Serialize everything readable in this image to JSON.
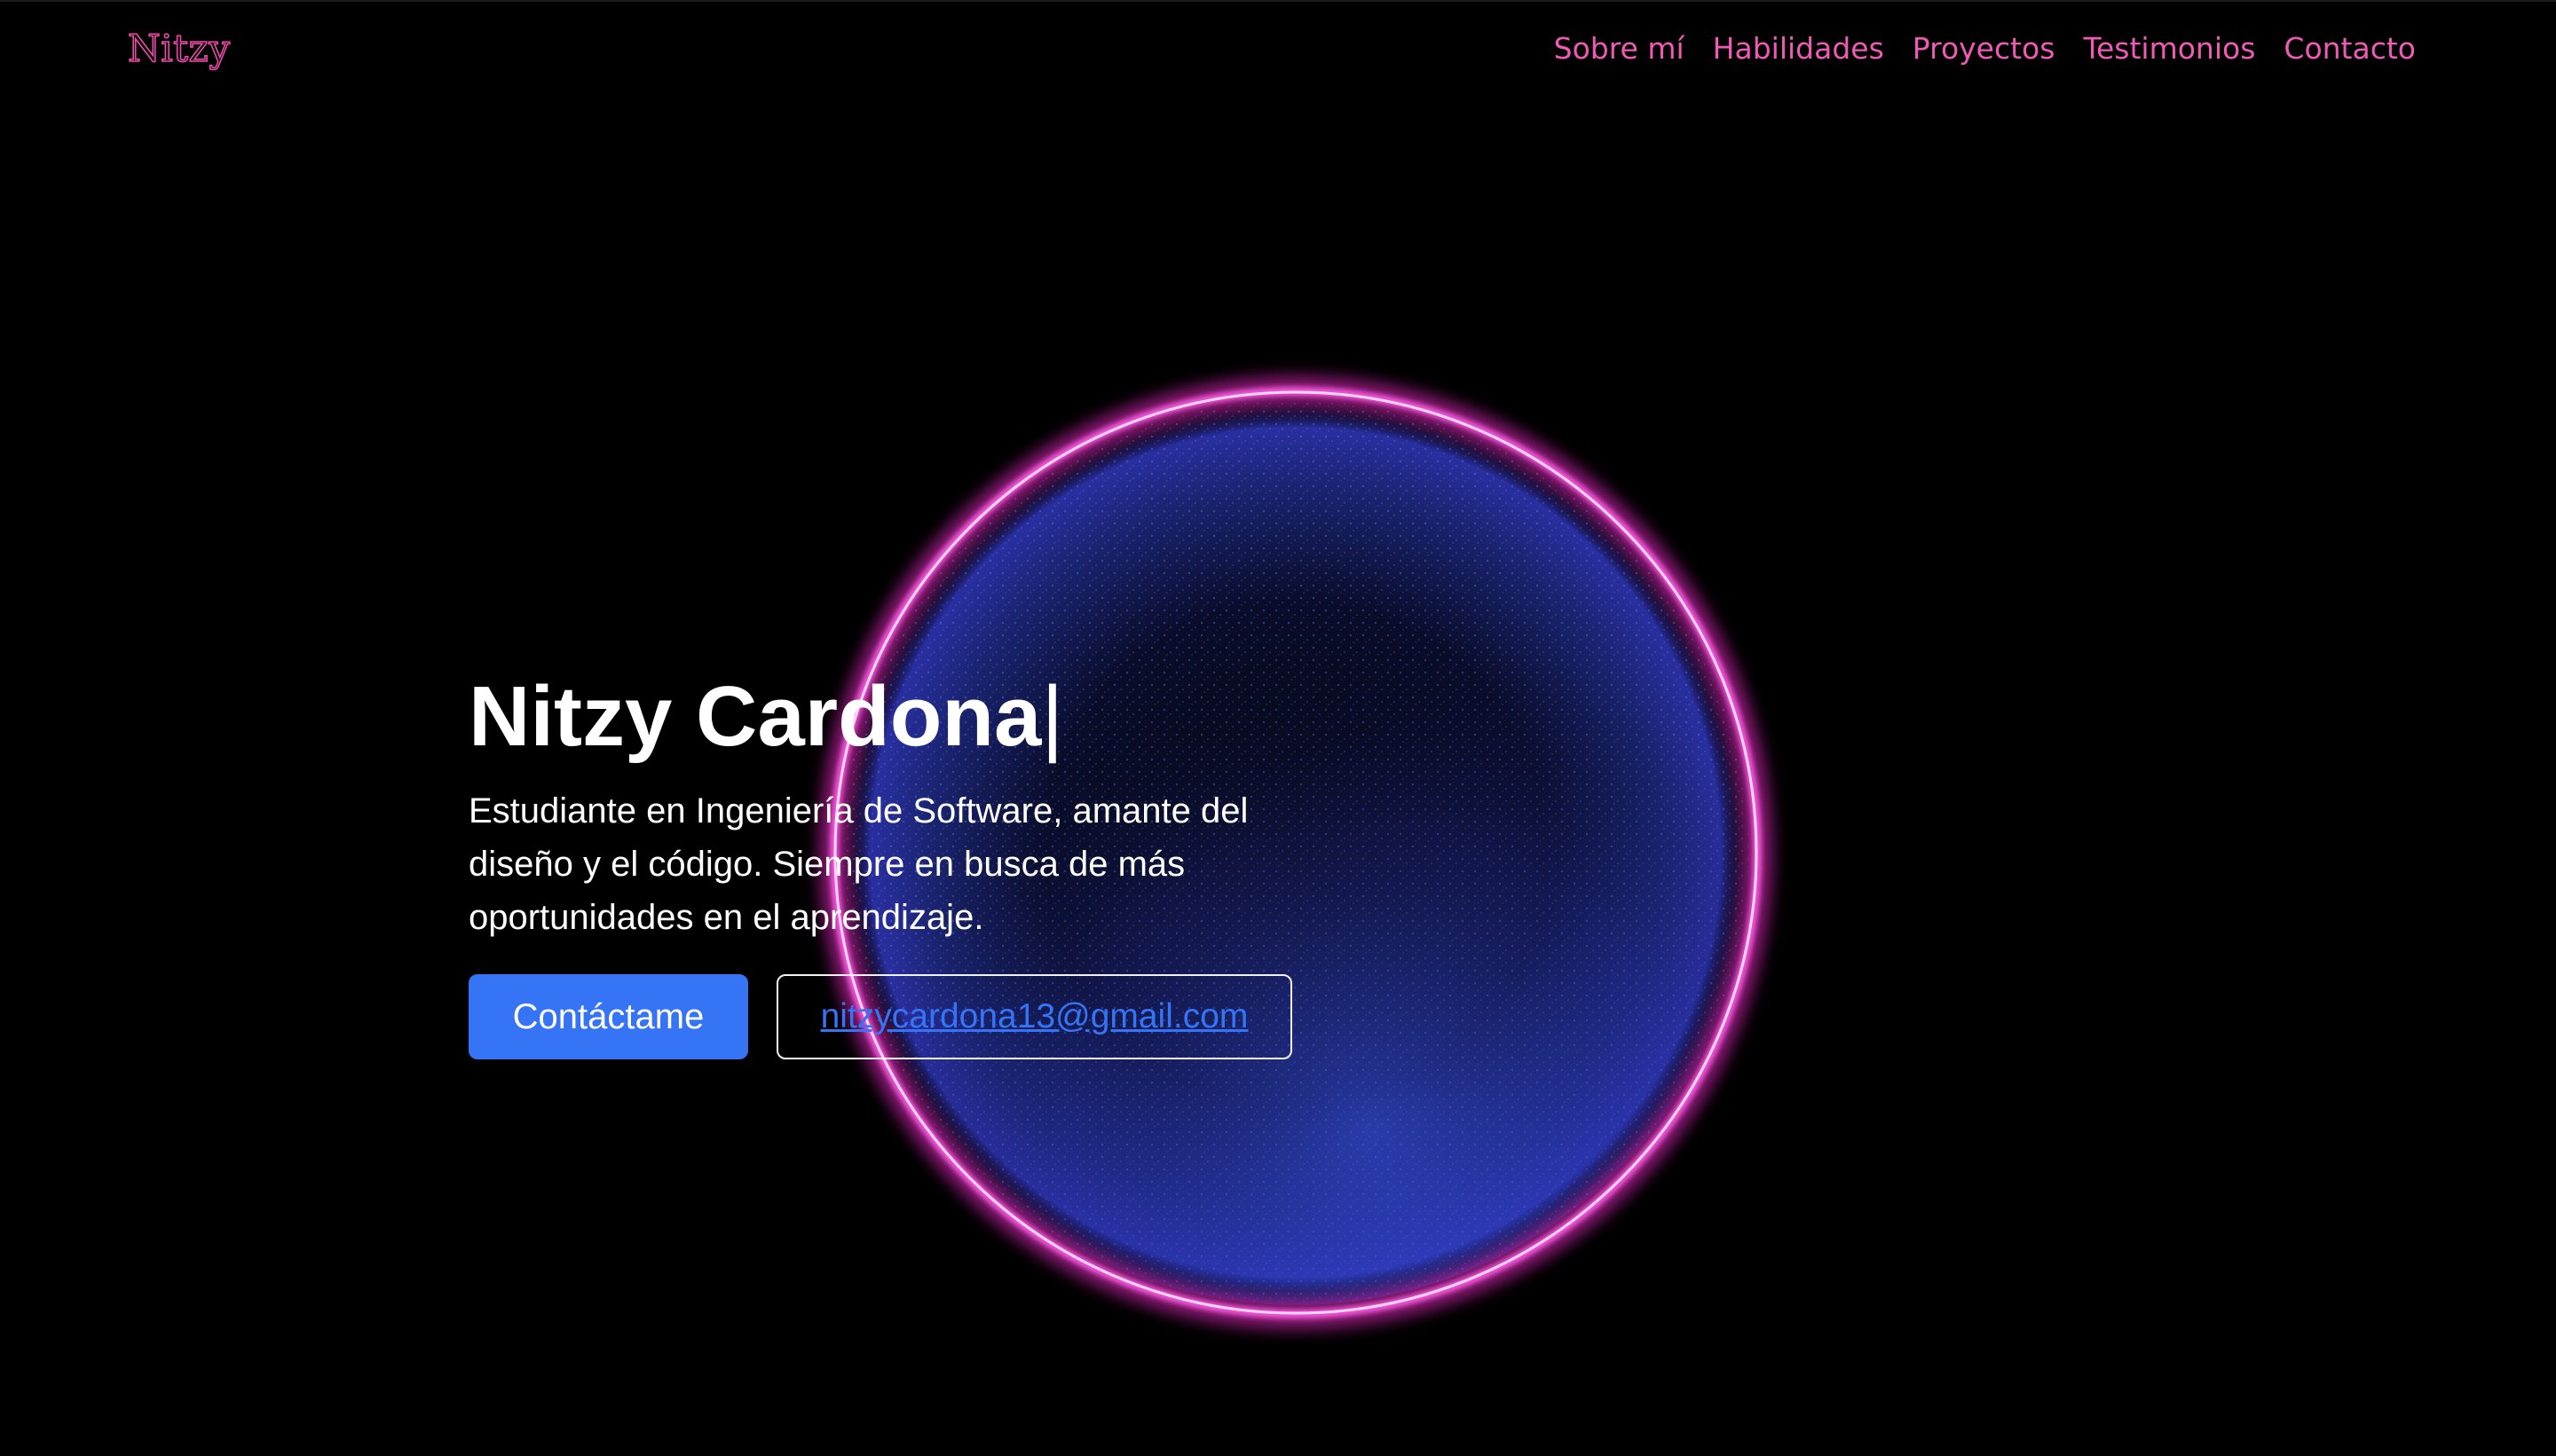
{
  "header": {
    "brand": "Nitzy",
    "nav": [
      "Sobre mí",
      "Habilidades",
      "Proyectos",
      "Testimonios",
      "Contacto"
    ]
  },
  "hero": {
    "title": "Nitzy Cardona",
    "cursor": "|",
    "description": "Estudiante en Ingeniería de Software, amante del diseño y el código. Siempre en busca de más oportunidades en el aprendizaje.",
    "primary_button": "Contáctame",
    "email": "nitzycardona13@gmail.com"
  },
  "colors": {
    "background": "#000000",
    "accent_pink": "#ee5bb5",
    "primary_blue": "#3574f5",
    "orb_ring": "#ff3fd8",
    "orb_particles": "#4a63ff"
  }
}
